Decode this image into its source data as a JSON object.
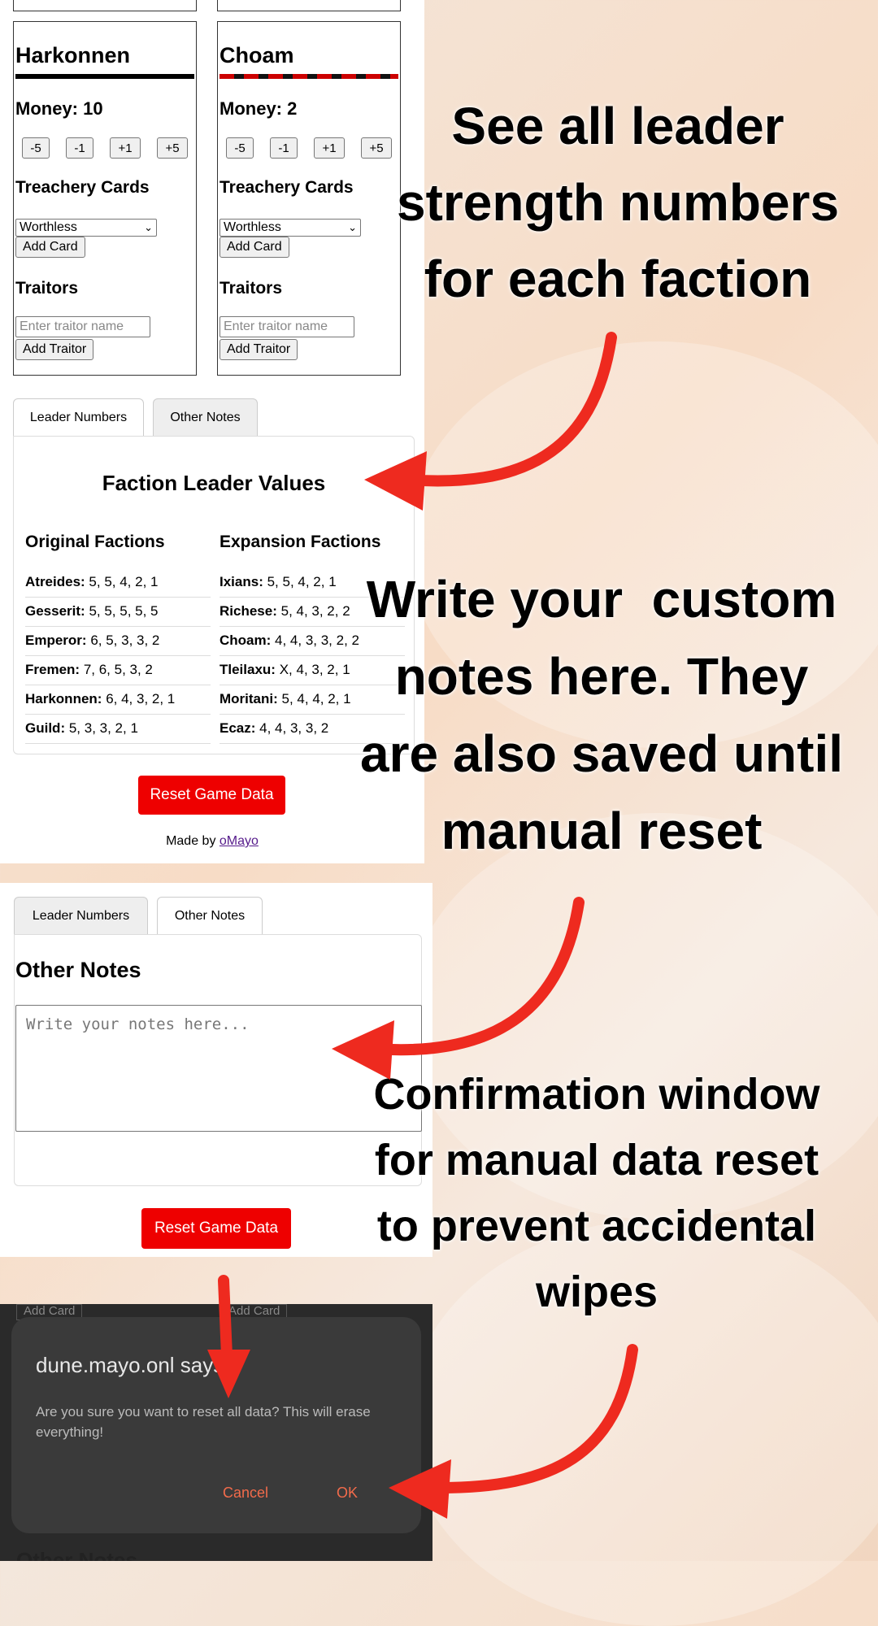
{
  "factions": [
    {
      "name": "Harkonnen",
      "money_label": "Money: 10",
      "buttons": [
        "-5",
        "-1",
        "+1",
        "+5"
      ],
      "treachery_label": "Treachery Cards",
      "select_value": "Worthless",
      "add_card_label": "Add Card",
      "traitors_label": "Traitors",
      "traitor_placeholder": "Enter traitor name",
      "add_traitor_label": "Add Traitor"
    },
    {
      "name": "Choam",
      "money_label": "Money: 2",
      "buttons": [
        "-5",
        "-1",
        "+1",
        "+5"
      ],
      "treachery_label": "Treachery Cards",
      "select_value": "Worthless",
      "add_card_label": "Add Card",
      "traitors_label": "Traitors",
      "traitor_placeholder": "Enter traitor name",
      "add_traitor_label": "Add Traitor"
    }
  ],
  "tabs": [
    "Leader Numbers",
    "Other Notes"
  ],
  "leader_values": {
    "title": "Faction Leader Values",
    "original_heading": "Original Factions",
    "expansion_heading": "Expansion Factions",
    "original": [
      {
        "name": "Atreides:",
        "values": "5, 5, 4, 2, 1"
      },
      {
        "name": "Gesserit:",
        "values": "5, 5, 5, 5, 5"
      },
      {
        "name": "Emperor:",
        "values": "6, 5, 3, 3, 2"
      },
      {
        "name": "Fremen:",
        "values": "7, 6, 5, 3, 2"
      },
      {
        "name": "Harkonnen:",
        "values": "6, 4, 3, 2, 1"
      },
      {
        "name": "Guild:",
        "values": "5, 3, 3, 2, 1"
      }
    ],
    "expansion": [
      {
        "name": "Ixians:",
        "values": "5, 5, 4, 2, 1"
      },
      {
        "name": "Richese:",
        "values": "5, 4, 3, 2, 2"
      },
      {
        "name": "Choam:",
        "values": "4, 4, 3, 3, 2, 2"
      },
      {
        "name": "Tleilaxu:",
        "values": "X, 4, 3, 2, 1"
      },
      {
        "name": "Moritani:",
        "values": "5, 4, 4, 2, 1"
      },
      {
        "name": "Ecaz:",
        "values": "4, 4, 3, 3, 2"
      }
    ]
  },
  "reset_button_label": "Reset Game Data",
  "made_by_prefix": "Made by ",
  "made_by_link": "oMayo",
  "other_notes": {
    "title": "Other Notes",
    "placeholder": "Write your notes here..."
  },
  "dialog": {
    "background_buttons": [
      "Add Card",
      "Add Card"
    ],
    "title": "dune.mayo.onl says",
    "message": "Are you sure you want to reset all data? This will erase everything!",
    "cancel_label": "Cancel",
    "ok_label": "OK",
    "background_heading": "Other Notes"
  },
  "headlines": {
    "h1": [
      "See all leader",
      "strength numbers",
      "for each faction"
    ],
    "h2": [
      "Write your  custom",
      "notes here. They",
      "are also saved until",
      "manual reset"
    ],
    "h3": [
      "Confirmation window",
      "for manual data reset",
      "to prevent accidental",
      "wipes"
    ]
  },
  "colors": {
    "arrow": "#ee2a1f",
    "reset_button": "#ee0000",
    "dialog_action": "#f26b4b"
  }
}
